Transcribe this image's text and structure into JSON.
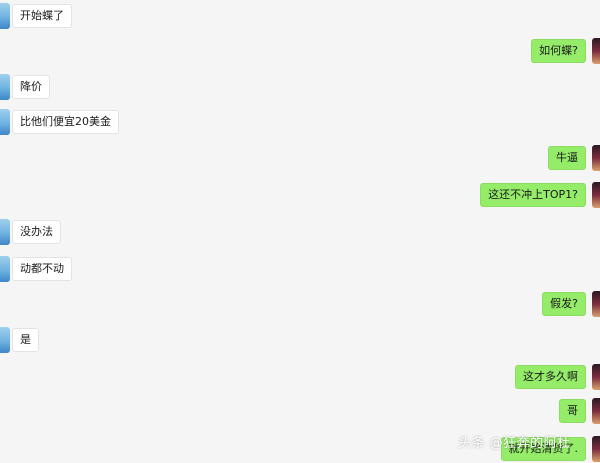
{
  "chat": {
    "messages": [
      {
        "side": "left",
        "text": "开始蝶了"
      },
      {
        "side": "right",
        "text": "如何蝶?"
      },
      {
        "side": "left",
        "text": "降价"
      },
      {
        "side": "left",
        "text": "比他们便宜20美金"
      },
      {
        "side": "right",
        "text": "牛逼"
      },
      {
        "side": "right",
        "text": "这还不冲上TOP1?"
      },
      {
        "side": "left",
        "text": "没办法"
      },
      {
        "side": "left",
        "text": "动都不动"
      },
      {
        "side": "right",
        "text": "假发?"
      },
      {
        "side": "left",
        "text": "是"
      },
      {
        "side": "right",
        "text": "这才多久啊"
      },
      {
        "side": "right",
        "text": "哥"
      },
      {
        "side": "right",
        "text": "就开始清货了."
      }
    ]
  },
  "watermark": {
    "text": "头条 @狂奔的阿杜"
  },
  "colors": {
    "outgoing_bubble": "#95ec69",
    "incoming_bubble": "#ffffff",
    "background": "#f5f5f5"
  }
}
